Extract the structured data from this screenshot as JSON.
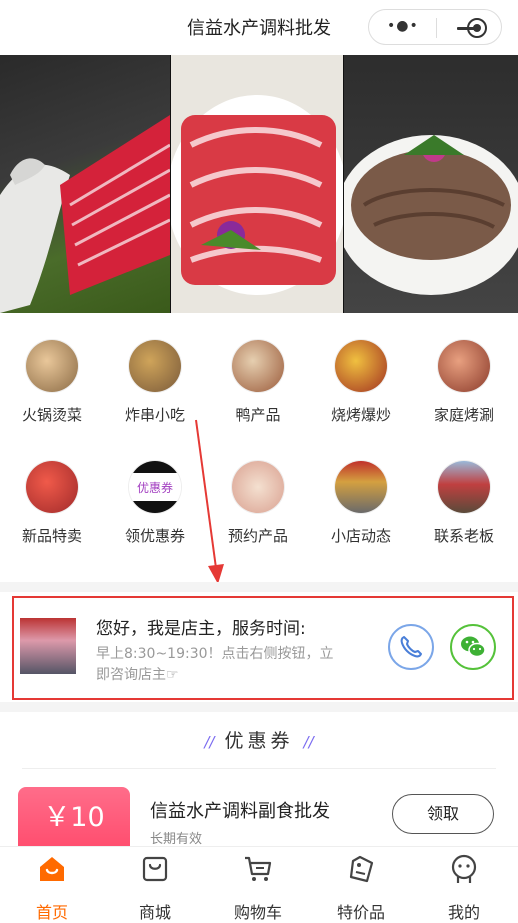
{
  "header": {
    "title": "信益水产调料批发"
  },
  "banner": {
    "slides": 7,
    "active": 1
  },
  "categories": [
    {
      "label": "火锅烫菜"
    },
    {
      "label": "炸串小吃"
    },
    {
      "label": "鸭产品"
    },
    {
      "label": "烧烤爆炒"
    },
    {
      "label": "家庭烤涮"
    },
    {
      "label": "新品特卖"
    },
    {
      "label": "领优惠券"
    },
    {
      "label": "预约产品"
    },
    {
      "label": "小店动态"
    },
    {
      "label": "联系老板"
    }
  ],
  "owner": {
    "greeting": "您好，我是店主，服务时间:",
    "hours": "早上8:30~19:30！点击右侧按钮，立即咨询店主☞"
  },
  "coupon_section": {
    "title": "优惠券",
    "coupon": {
      "amount": "￥10",
      "shop": "信益水产调料副食批发",
      "validity": "长期有效",
      "button": "领取"
    }
  },
  "tabbar": {
    "items": [
      {
        "label": "首页"
      },
      {
        "label": "商城"
      },
      {
        "label": "购物车"
      },
      {
        "label": "特价品"
      },
      {
        "label": "我的"
      }
    ],
    "active_color": "#ff6a00"
  }
}
